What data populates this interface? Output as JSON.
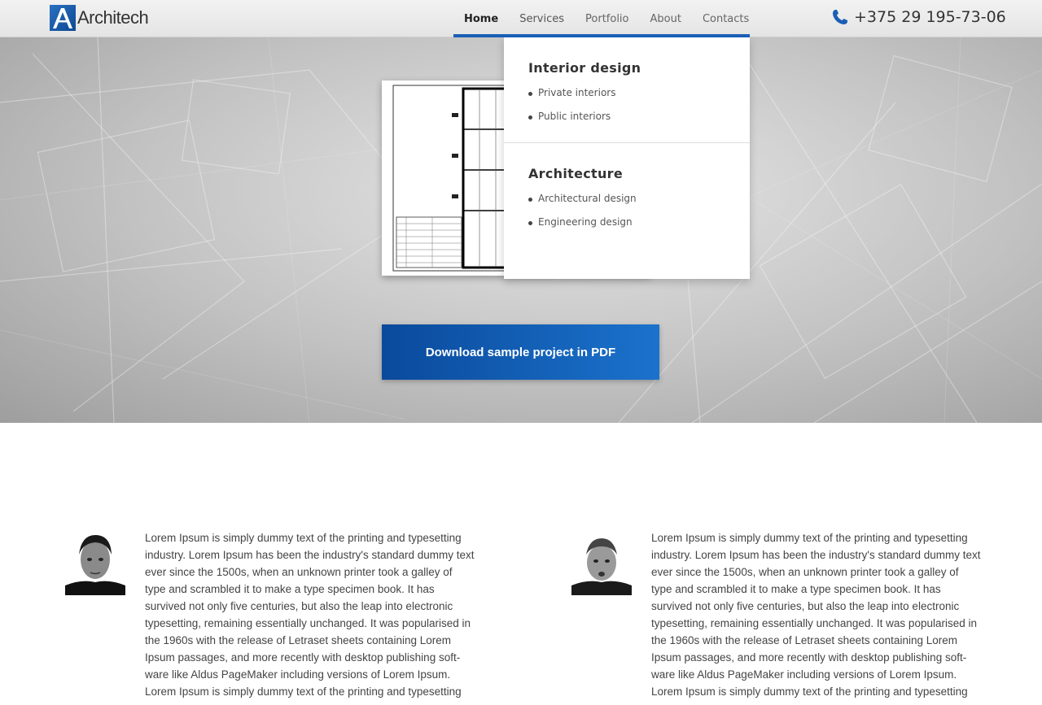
{
  "header": {
    "logo_text": "Architech",
    "nav": [
      "Home",
      "Services",
      "Portfolio",
      "About",
      "Contacts"
    ],
    "phone": "+375 29 195-73-06"
  },
  "dropdown": {
    "sections": [
      {
        "title": "Interior design",
        "items": [
          "Private interiors",
          "Public interiors"
        ]
      },
      {
        "title": "Architecture",
        "items": [
          "Architectural design",
          "Engineering design"
        ]
      }
    ]
  },
  "hero": {
    "download_label": "Download sample project in PDF"
  },
  "testimonials": [
    {
      "text": "Lorem Ipsum is simply dummy text of the printing and typesetting industry. Lorem Ipsum has been the industry's standard dummy text ever since the 1500s, when an unknown printer took a galley of type and scrambled it to make a type specimen book. It has survived not only five centuries, but also the leap into electronic typesetting, remaining essentially unchanged. It was popularised in the 1960s with the release of Letraset sheets containing Lorem Ipsum passages, and more recently with desktop publishing soft-ware like Aldus PageMaker including versions of Lorem Ipsum. Lorem Ipsum is simply dummy text of the printing and typesetting"
    },
    {
      "text": "Lorem Ipsum is simply dummy text of the printing and typesetting industry. Lorem Ipsum has been the industry's standard dummy text ever since the 1500s, when an unknown printer took a galley of type and scrambled it to make a type specimen book. It has survived not only five centuries, but also the leap into electronic typesetting, remaining essentially unchanged. It was popularised in the 1960s with the release of Letraset sheets containing Lorem Ipsum passages, and more recently with desktop publishing soft-ware like Aldus PageMaker including versions of Lorem Ipsum. Lorem Ipsum is simply dummy text of the printing and typesetting"
    }
  ],
  "colors": {
    "accent": "#1a5fb4",
    "button": "#0f5cb0"
  }
}
